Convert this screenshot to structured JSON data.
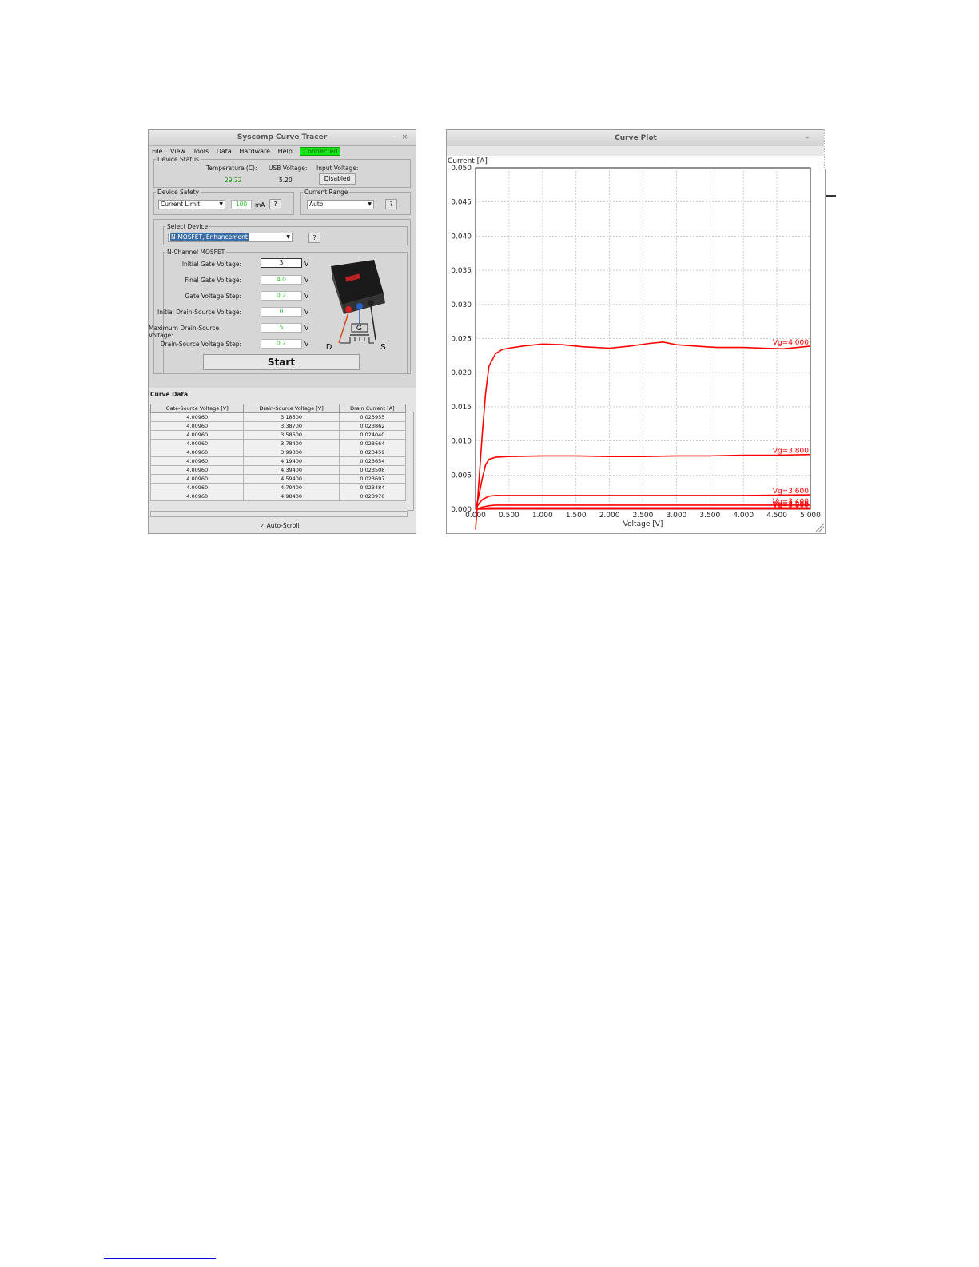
{
  "tracer": {
    "title": "Syscomp Curve Tracer",
    "min": "–",
    "close": "×",
    "menu": [
      "File",
      "View",
      "Tools",
      "Data",
      "Hardware",
      "Help"
    ],
    "status": "Connected",
    "device_status": {
      "legend": "Device Status",
      "temperature_label": "Temperature (C):",
      "temperature_value": "29.22",
      "usb_label": "USB Voltage:",
      "usb_value": "5.20",
      "input_label": "Input Voltage:",
      "input_button": "Disabled"
    },
    "device_safety": {
      "legend": "Device Safety",
      "mode": "Current Limit",
      "limit_value": "100",
      "limit_unit": "mA",
      "help": "?"
    },
    "current_range": {
      "legend": "Current Range",
      "value": "Auto",
      "help": "?"
    },
    "select_device": {
      "legend": "Select Device",
      "value": "N-MOSFET, Enhancement",
      "help": "?"
    },
    "mosfet": {
      "legend": "N-Channel MOSFET",
      "fields": [
        {
          "label": "Initial Gate Voltage:",
          "value": "3",
          "unit": "V"
        },
        {
          "label": "Final Gate Voltage:",
          "value": "4.0",
          "unit": "V"
        },
        {
          "label": "Gate Voltage Step:",
          "value": "0.2",
          "unit": "V"
        },
        {
          "label": "Initial Drain-Source Voltage:",
          "value": "0",
          "unit": "V"
        },
        {
          "label": "Maximum Drain-Source Voltage:",
          "value": "5",
          "unit": "V"
        },
        {
          "label": "Drain-Source Voltage Step:",
          "value": "0.2",
          "unit": "V"
        }
      ],
      "pins": {
        "d": "D",
        "g": "G",
        "s": "S"
      },
      "start": "Start"
    },
    "curve_data": {
      "title": "Curve Data",
      "headers": [
        "Gate-Source Voltage [V]",
        "Drain-Source Voltage [V]",
        "Drain Current [A]"
      ],
      "rows": [
        [
          "4.00960",
          "3.18500",
          "0.023955"
        ],
        [
          "4.00960",
          "3.38700",
          "0.023862"
        ],
        [
          "4.00960",
          "3.58600",
          "0.024040"
        ],
        [
          "4.00960",
          "3.78400",
          "0.023664"
        ],
        [
          "4.00960",
          "3.99300",
          "0.023459"
        ],
        [
          "4.00960",
          "4.19400",
          "0.023654"
        ],
        [
          "4.00960",
          "4.39400",
          "0.023508"
        ],
        [
          "4.00960",
          "4.59400",
          "0.023697"
        ],
        [
          "4.00960",
          "4.79400",
          "0.023484"
        ],
        [
          "4.00960",
          "4.98400",
          "0.023976"
        ]
      ],
      "auto_scroll": "✓ Auto-Scroll"
    }
  },
  "plot": {
    "title": "Curve Plot",
    "min": "–",
    "chart_data": {
      "type": "line",
      "xlabel": "Voltage [V]",
      "ylabel": "Current [A]",
      "xlim": [
        0,
        5.0
      ],
      "ylim": [
        0,
        0.05
      ],
      "xticks": [
        "0.000",
        "0.500",
        "1.000",
        "1.500",
        "2.000",
        "2.500",
        "3.000",
        "3.500",
        "4.000",
        "4.500",
        "5.000"
      ],
      "yticks": [
        "0.000",
        "0.005",
        "0.010",
        "0.015",
        "0.020",
        "0.025",
        "0.030",
        "0.035",
        "0.040",
        "0.045",
        "0.050"
      ],
      "grid": true,
      "color": "#ff0000",
      "series": [
        {
          "name": "Vg=4.000",
          "x": [
            0,
            0.05,
            0.1,
            0.15,
            0.2,
            0.3,
            0.4,
            0.5,
            0.7,
            1.0,
            1.3,
            1.6,
            2.0,
            2.3,
            2.6,
            2.8,
            3.0,
            3.3,
            3.6,
            4.0,
            4.3,
            4.6,
            5.0
          ],
          "y": [
            -0.003,
            0.004,
            0.011,
            0.017,
            0.021,
            0.0228,
            0.0234,
            0.0236,
            0.0239,
            0.0242,
            0.0241,
            0.0238,
            0.0236,
            0.0239,
            0.0243,
            0.0245,
            0.0241,
            0.0239,
            0.0237,
            0.0237,
            0.0236,
            0.0235,
            0.0239
          ]
        },
        {
          "name": "Vg=3.800",
          "x": [
            0,
            0.05,
            0.1,
            0.15,
            0.2,
            0.3,
            0.5,
            1.0,
            1.5,
            2.0,
            2.5,
            3.0,
            3.5,
            4.0,
            4.5,
            5.0
          ],
          "y": [
            0,
            0.002,
            0.0045,
            0.0065,
            0.0073,
            0.0076,
            0.0077,
            0.0078,
            0.0078,
            0.0077,
            0.0077,
            0.0078,
            0.0078,
            0.0079,
            0.0079,
            0.008
          ]
        },
        {
          "name": "Vg=3.600",
          "x": [
            0,
            0.05,
            0.1,
            0.2,
            0.3,
            0.5,
            1.0,
            2.0,
            3.0,
            4.0,
            5.0
          ],
          "y": [
            0,
            0.0008,
            0.0014,
            0.0019,
            0.002,
            0.002,
            0.002,
            0.002,
            0.002,
            0.002,
            0.0021
          ]
        },
        {
          "name": "Vg=3.400",
          "x": [
            0,
            0.1,
            0.2,
            0.3,
            0.5,
            1.0,
            2.0,
            3.0,
            4.0,
            5.0
          ],
          "y": [
            0,
            0.0003,
            0.0005,
            0.0006,
            0.0006,
            0.0006,
            0.0006,
            0.0006,
            0.0006,
            0.0006
          ]
        },
        {
          "name": "Vg=3.200",
          "x": [
            0,
            0.1,
            0.2,
            0.5,
            1.0,
            2.0,
            3.0,
            4.0,
            5.0
          ],
          "y": [
            0,
            0.0001,
            0.0002,
            0.0002,
            0.0002,
            0.0002,
            0.0002,
            0.0002,
            0.0002
          ]
        },
        {
          "name": "Vg=3.000",
          "x": [
            0,
            0.5,
            1.0,
            2.0,
            3.0,
            4.0,
            5.0
          ],
          "y": [
            0,
            5e-05,
            5e-05,
            5e-05,
            5e-05,
            5e-05,
            5e-05
          ]
        }
      ]
    }
  }
}
